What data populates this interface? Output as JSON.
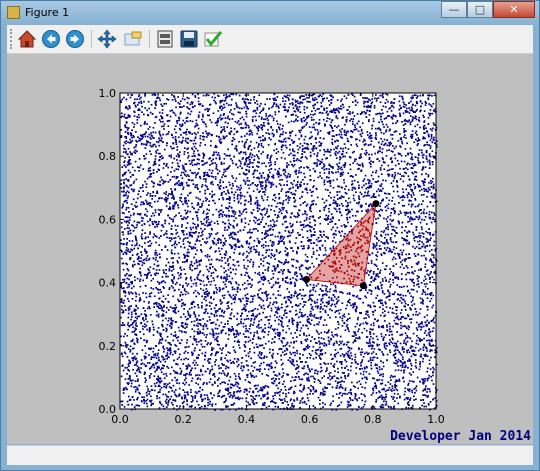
{
  "window": {
    "title": "Figure 1"
  },
  "titlebar_buttons": {
    "minimize": "—",
    "maximize": "□",
    "close": "✕"
  },
  "toolbar": {
    "items": [
      {
        "name": "home",
        "icon": "home-icon"
      },
      {
        "name": "back",
        "icon": "back-arrow-icon"
      },
      {
        "name": "forward",
        "icon": "forward-arrow-icon"
      },
      {
        "name": "pan",
        "icon": "pan-arrows-icon"
      },
      {
        "name": "zoom",
        "icon": "zoom-rect-icon"
      },
      {
        "name": "subplots",
        "icon": "subplots-config-icon"
      },
      {
        "name": "save",
        "icon": "floppy-disk-icon"
      },
      {
        "name": "edit",
        "icon": "checkmark-icon"
      }
    ]
  },
  "figure": {
    "credit": "Developer Jan 2014"
  },
  "chart_data": {
    "type": "scatter",
    "xlim": [
      0.0,
      1.0
    ],
    "ylim": [
      0.0,
      1.0
    ],
    "x_ticks": [
      "0.0",
      "0.2",
      "0.4",
      "0.6",
      "0.8",
      "1.0"
    ],
    "y_ticks": [
      "0.0",
      "0.2",
      "0.4",
      "0.6",
      "0.8",
      "1.0"
    ],
    "background_points_color": "#00008b",
    "highlight_color": "#b00000",
    "triangle_vertices": [
      {
        "x": 0.59,
        "y": 0.41
      },
      {
        "x": 0.77,
        "y": 0.39
      },
      {
        "x": 0.81,
        "y": 0.65
      }
    ],
    "vertex_color": "#000000"
  },
  "colors": {
    "plot_background": "#ffffff",
    "figure_background": "#bfbfbf"
  }
}
